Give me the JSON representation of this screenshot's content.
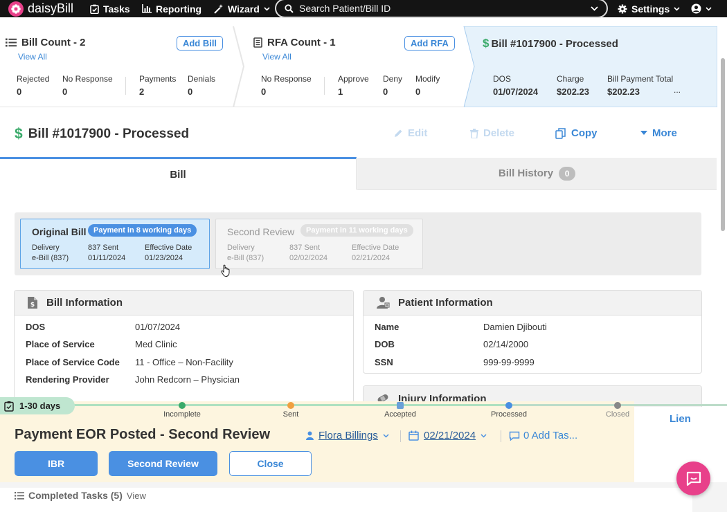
{
  "nav": {
    "logo_text": "daisyBill",
    "tasks": "Tasks",
    "reporting": "Reporting",
    "wizard": "Wizard",
    "search_placeholder": "Search Patient/Bill ID",
    "settings": "Settings"
  },
  "summary": {
    "bill_count": {
      "title": "Bill Count - 2",
      "view_all": "View All",
      "add_label": "Add Bill",
      "stats": [
        {
          "label": "Rejected",
          "value": "0"
        },
        {
          "label": "No Response",
          "value": "0"
        },
        {
          "label": "Payments",
          "value": "2"
        },
        {
          "label": "Denials",
          "value": "0"
        }
      ]
    },
    "rfa_count": {
      "title": "RFA Count - 1",
      "view_all": "View All",
      "add_label": "Add RFA",
      "stats": [
        {
          "label": "No Response",
          "value": "0"
        },
        {
          "label": "Approve",
          "value": "1"
        },
        {
          "label": "Deny",
          "value": "0"
        },
        {
          "label": "Modify",
          "value": "0"
        }
      ]
    },
    "bill": {
      "title": "Bill #1017900 - Processed",
      "stats": [
        {
          "label": "DOS",
          "value": "01/07/2024"
        },
        {
          "label": "Charge",
          "value": "$202.23"
        },
        {
          "label": "Bill Payment Total",
          "value": "$202.23"
        }
      ],
      "more": "..."
    }
  },
  "header": {
    "title": "Bill #1017900 - Processed",
    "edit": "Edit",
    "delete": "Delete",
    "copy": "Copy",
    "more": "More"
  },
  "tabs": {
    "bill": "Bill",
    "history": "Bill History",
    "history_count": "0"
  },
  "submissions": {
    "original": {
      "title": "Original Bill",
      "badge": "Payment in 8 working days",
      "delivery_label": "Delivery",
      "delivery_value": "e-Bill (837)",
      "sent_label": "837 Sent",
      "sent_value": "01/11/2024",
      "eff_label": "Effective Date",
      "eff_value": "01/23/2024"
    },
    "second": {
      "title": "Second Review",
      "badge": "Payment in 11 working days",
      "delivery_label": "Delivery",
      "delivery_value": "e-Bill (837)",
      "sent_label": "837 Sent",
      "sent_value": "02/02/2024",
      "eff_label": "Effective Date",
      "eff_value": "02/21/2024"
    }
  },
  "bill_info": {
    "title": "Bill Information",
    "rows": [
      {
        "k": "DOS",
        "v": "01/07/2024"
      },
      {
        "k": "Place of Service",
        "v": "Med Clinic"
      },
      {
        "k": "Place of Service Code",
        "v": "11 - Office – Non-Facility"
      },
      {
        "k": "Rendering Provider",
        "v": "John Redcorn – Physician"
      }
    ]
  },
  "patient_info": {
    "title": "Patient Information",
    "rows": [
      {
        "k": "Name",
        "v": "Damien Djibouti"
      },
      {
        "k": "DOB",
        "v": "02/14/2000"
      },
      {
        "k": "SSN",
        "v": "999-99-9999"
      }
    ]
  },
  "injury_info": {
    "title": "Injury Information"
  },
  "lien_label": "Lien",
  "task": {
    "age_badge": "1-30 days",
    "stages": [
      "Incomplete",
      "Sent",
      "Accepted",
      "Processed",
      "Closed"
    ],
    "title": "Payment EOR Posted - Second Review",
    "assignee": "Flora Billings",
    "due_date": "02/21/2024",
    "add_task": "0 Add Tas...",
    "buttons": {
      "ibr": "IBR",
      "second_review": "Second Review",
      "close": "Close"
    }
  },
  "completed": {
    "label": "Completed Tasks (5)",
    "view": "View"
  },
  "colors": {
    "accent": "#4a90e2",
    "brand_pink": "#e8408a",
    "success_green": "#3aaa6a",
    "footer_bg": "#fdf5df"
  }
}
